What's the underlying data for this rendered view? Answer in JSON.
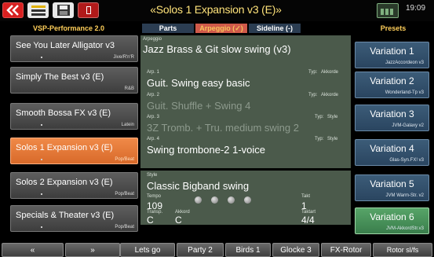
{
  "window": {
    "title": "«Solos 1 Expansion v3 (E)»",
    "time": "19:09"
  },
  "icons": {
    "back": "back-arrows-icon",
    "lines": "style-lines-icon",
    "disk": "disk-icon",
    "red": "red-square-icon",
    "status": "battery-status-icon"
  },
  "left_header": "VSP-Performance 2.0",
  "tabs": {
    "parts": "Parts",
    "arpeggio": "Arpeggio (✓)",
    "sideline": "Sideline (-)"
  },
  "right_header": "Presets",
  "left_list": [
    {
      "name": "See You Later Alligator v3",
      "genre": "Jive/R'n'R"
    },
    {
      "name": "Simply The Best v3 (E)",
      "genre": "R&B"
    },
    {
      "name": "Smooth Bossa FX v3 (E)",
      "genre": "Latein"
    },
    {
      "name": "Solos 1 Expansion v3 (E)",
      "genre": "Pop/Beat"
    },
    {
      "name": "Solos 2 Expansion v3 (E)",
      "genre": "Pop/Beat"
    },
    {
      "name": "Specials & Theater v3 (E)",
      "genre": "Pop/Beat"
    }
  ],
  "arpeggio": {
    "label": "Arpeggio",
    "name": "Jazz Brass & Git slow swing (v3)",
    "typ_label": "Typ:",
    "arps": [
      {
        "label": "Arp. 1",
        "name": "Guit. Swing easy basic",
        "type": "Akkorde"
      },
      {
        "label": "Arp. 2",
        "name": "Guit. Shuffle + Swing 4",
        "type": "Akkorde"
      },
      {
        "label": "Arp. 3",
        "name": "3Z Tromb. + Tru. medium swing 2",
        "type": "Style"
      },
      {
        "label": "Arp. 4",
        "name": "Swing trombone-2 1-voice",
        "type": "Style"
      }
    ]
  },
  "style": {
    "label": "Style",
    "name": "Classic Bigband swing",
    "tempo_label": "Tempo",
    "tempo": "109",
    "takt_label": "Takt",
    "takt": "1",
    "transp_label": "Transp.",
    "transp": "C",
    "akkord_label": "Akkord",
    "akkord": "C",
    "taktart_label": "Taktart",
    "taktart": "4/4"
  },
  "variations": [
    {
      "name": "Variation 1",
      "sub": "JazzAccordeon v3"
    },
    {
      "name": "Variation 2",
      "sub": "Wonderland-Tp v3"
    },
    {
      "name": "Variation 3",
      "sub": "JVM-Galaxy v2"
    },
    {
      "name": "Variation 4",
      "sub": "Glas-Syn.FX! v3"
    },
    {
      "name": "Variation 5",
      "sub": "JVM Warm-Str. v2"
    },
    {
      "name": "Variation 6",
      "sub": "JVM-AkkordStr.v3"
    }
  ],
  "bottom": [
    "«",
    "»",
    "Lets go",
    "Party 2",
    "Birds 1",
    "Glocke 3",
    "FX-Rotor",
    "Rotor sl/fs"
  ]
}
